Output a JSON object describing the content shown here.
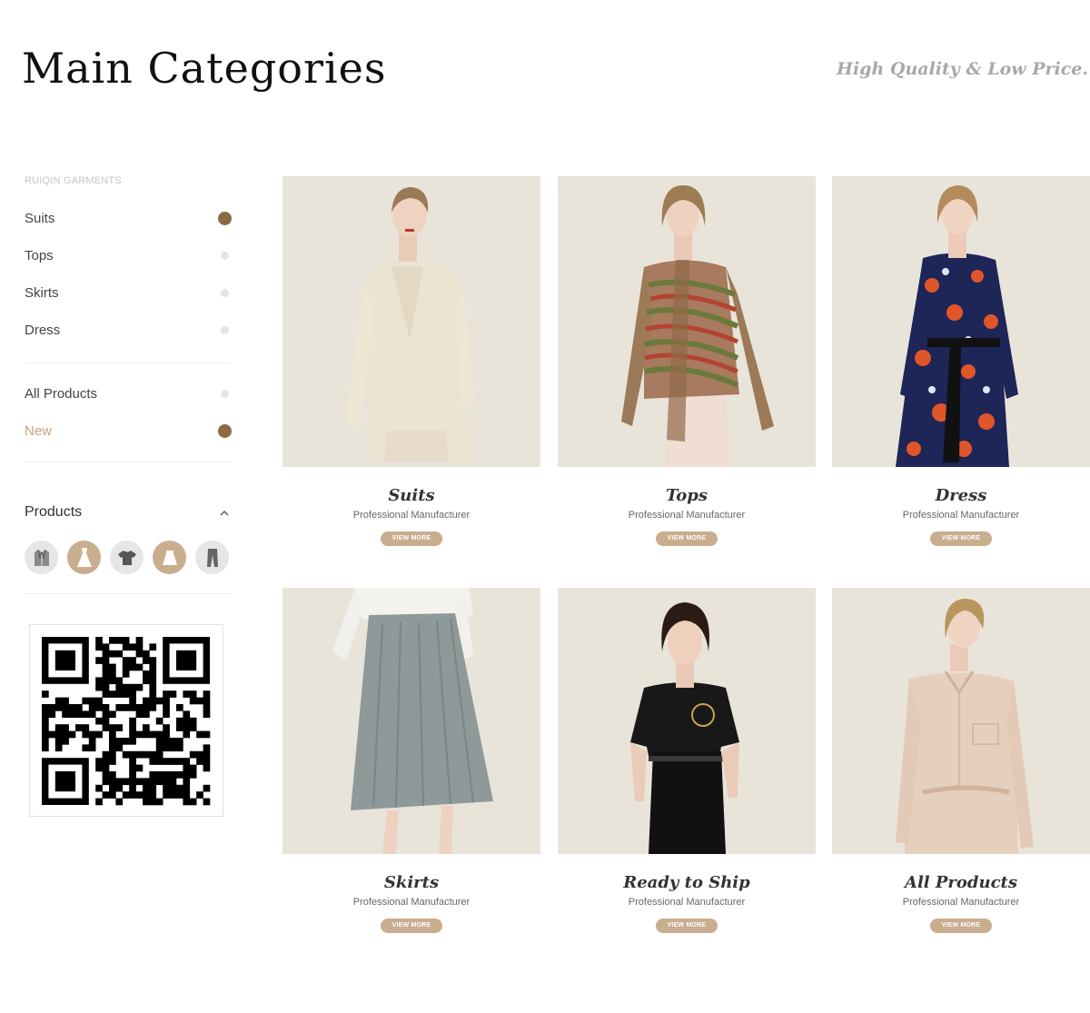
{
  "header": {
    "title": "Main Categories",
    "tagline": "High Quality & Low Price."
  },
  "sidebar": {
    "brand": "RUIQIN GARMENTS",
    "categories": [
      {
        "label": "Suits",
        "active": true
      },
      {
        "label": "Tops",
        "active": false
      },
      {
        "label": "Skirts",
        "active": false
      },
      {
        "label": "Dress",
        "active": false
      }
    ],
    "secondary": [
      {
        "label": "All Products",
        "active": false
      },
      {
        "label": "New",
        "active": true
      }
    ],
    "products_heading": "Products",
    "product_icons": [
      "jacket-icon",
      "dress-icon",
      "tshirt-icon",
      "skirt-icon",
      "trousers-icon"
    ]
  },
  "cards": [
    {
      "title": "Suits",
      "subtitle": "Professional Manufacturer",
      "button": "VIEW MORE"
    },
    {
      "title": "Tops",
      "subtitle": "Professional Manufacturer",
      "button": "VIEW MORE"
    },
    {
      "title": "Dress",
      "subtitle": "Professional Manufacturer",
      "button": "VIEW MORE"
    },
    {
      "title": "Skirts",
      "subtitle": "Professional Manufacturer",
      "button": "VIEW MORE"
    },
    {
      "title": "Ready to Ship",
      "subtitle": "Professional Manufacturer",
      "button": "VIEW MORE"
    },
    {
      "title": "All Products",
      "subtitle": "Professional Manufacturer",
      "button": "VIEW MORE"
    }
  ],
  "colors": {
    "accent_dark": "#8b6a3f",
    "accent_tan": "#c9ad8f",
    "new_text": "#c9a27b",
    "photo_bg": "#e9e4da"
  }
}
